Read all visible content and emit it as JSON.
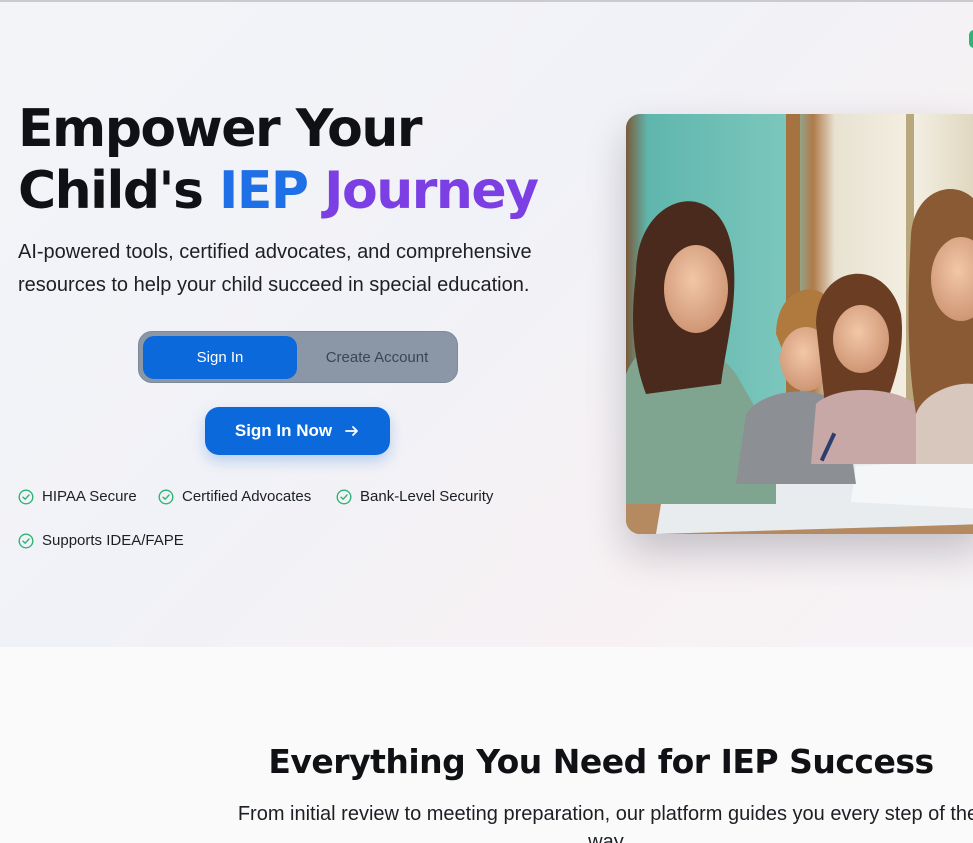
{
  "hero": {
    "headline_line1": "Empower Your",
    "headline_line2_prefix": "Child's ",
    "headline_highlight_blue": "IEP",
    "headline_highlight_purple": "Journey",
    "subtitle": "AI-powered tools, certified advocates, and comprehensive resources to help your child succeed in special education."
  },
  "auth": {
    "tabs": [
      {
        "label": "Sign In",
        "active": true
      },
      {
        "label": "Create Account",
        "active": false
      }
    ],
    "cta_label": "Sign In Now",
    "cta_icon": "arrow-right-icon"
  },
  "badges": [
    {
      "label": "HIPAA Secure",
      "icon": "check-circle-icon"
    },
    {
      "label": "Certified Advocates",
      "icon": "check-circle-icon"
    },
    {
      "label": "Bank-Level Security",
      "icon": "check-circle-icon"
    },
    {
      "label": "Supports IDEA/FAPE",
      "icon": "check-circle-icon"
    }
  ],
  "features": {
    "title": "Everything You Need for IEP Success",
    "subtitle": "From initial review to meeting preparation, our platform guides you every step of the way."
  },
  "colors": {
    "primary": "#0b69dc",
    "accent_blue": "#1f6fe6",
    "accent_purple": "#7b3fe4",
    "check_green": "#2fb476",
    "toggle_bg": "#8b97a6"
  }
}
